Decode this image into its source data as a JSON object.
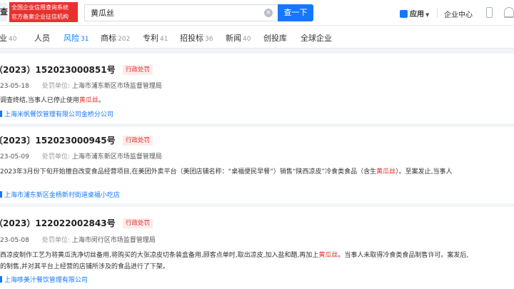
{
  "header": {
    "logo_mark": "查",
    "logo_line1": "全国企业信用查询系统",
    "logo_line2": "官方备案企业征信机构",
    "search_value": "黄瓜丝",
    "search_button": "查一下",
    "app_menu": "应用",
    "enterprise_center": "企业中心"
  },
  "tabs": [
    {
      "label": "企业",
      "count": "40",
      "active": false
    },
    {
      "label": "人员",
      "count": "",
      "active": false
    },
    {
      "label": "风险",
      "count": "31",
      "active": true
    },
    {
      "label": "商标",
      "count": "202",
      "active": false
    },
    {
      "label": "专利",
      "count": "41",
      "active": false
    },
    {
      "label": "招投标",
      "count": "36",
      "active": false
    },
    {
      "label": "新闻",
      "count": "40",
      "active": false
    },
    {
      "label": "创投库",
      "count": "",
      "active": false
    },
    {
      "label": "全球企业",
      "count": "",
      "active": false
    }
  ],
  "results": [
    {
      "title": "（2023）152023000851号",
      "badge": "行政处罚",
      "date": "23-05-18",
      "authority_label": "处罚单位:",
      "authority": "上海市浦东新区市场监督管理局",
      "desc_pre": "调查终结,当事人已停止使用",
      "desc_hl": "黄瓜丝",
      "desc_post": "。",
      "company": "上海米帆餐饮管理有限公司金桥分公司"
    },
    {
      "title": "〔2023〕152023000945号",
      "badge": "行政处罚",
      "date": "23-05-09",
      "authority_label": "处罚单位:",
      "authority": "上海市浦东新区市场监督管理局",
      "desc_pre": "2023年3月份下旬开始擅自改变食品经营项目,在美团外卖平台（美团店铺名称：“桌福便民早餐”）销售“陕西凉皮”冷食类食品（含生",
      "desc_hl": "黄瓜丝",
      "desc_post": "）。至案发止,当事人",
      "company": "上海市浦东新区金杨新村街道桌福小吃店"
    },
    {
      "title": "（2023）122022002843号",
      "badge": "行政处罚",
      "date": "23-05-08",
      "authority_label": "处罚单位:",
      "authority": "上海市闵行区市场监督管理局",
      "desc_pre": "西凉皮制作工艺为将黄瓜洗净切丝备用,将购买的大张凉皮切条装盒备用,顾客点单时,取出凉皮,加入盐和醋,再加上",
      "desc_hl": "黄瓜丝",
      "desc_post": "。当事人未取得冷食类食品制售许可。案发后,",
      "desc2": "的制售,并对其平台上经营的店铺所涉及的食品进行了下架。",
      "company": "上海哆美汁餐饮管理有限公司"
    }
  ],
  "colors": {
    "accent": "#1677ff",
    "danger": "#e8312f"
  }
}
